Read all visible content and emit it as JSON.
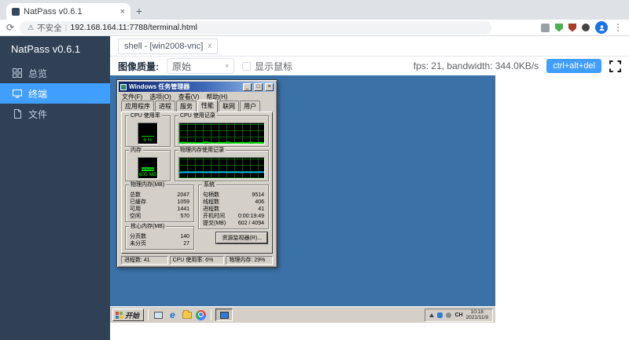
{
  "browser": {
    "tab": {
      "title": "NatPass v0.6.1",
      "close": "×"
    },
    "new_tab": "+",
    "security_label": "不安全",
    "url": "192.168.164.11:7788/terminal.html"
  },
  "sidebar": {
    "brand": "NatPass v0.6.1",
    "items": [
      {
        "label": "总览"
      },
      {
        "label": "终端"
      },
      {
        "label": "文件"
      }
    ]
  },
  "shell": {
    "tab_label": "shell - [win2008-vnc]",
    "tab_close": "x"
  },
  "toolbar": {
    "quality_label": "图像质量:",
    "quality_value": "原始",
    "show_cursor_label": "显示鼠标",
    "stats": "fps: 21, bandwidth: 344.0KB/s",
    "cad_button": "ctrl+alt+del"
  },
  "taskmgr": {
    "title": "Windows 任务管理器",
    "window_buttons": {
      "min": "_",
      "max": "□",
      "close": "×"
    },
    "menu": [
      {
        "label": "文件(F)"
      },
      {
        "label": "选项(O)"
      },
      {
        "label": "查看(V)"
      },
      {
        "label": "帮助(H)"
      }
    ],
    "tabs": [
      {
        "label": "应用程序"
      },
      {
        "label": "进程"
      },
      {
        "label": "服务"
      },
      {
        "label": "性能"
      },
      {
        "label": "联网"
      },
      {
        "label": "用户"
      }
    ],
    "cpu_gauge": {
      "title": "CPU 使用率",
      "value": "6 %",
      "percent": 8
    },
    "cpu_history": {
      "title": "CPU 使用记录",
      "values": [
        4,
        6,
        3,
        5,
        3,
        4,
        7,
        4,
        3,
        5,
        4,
        6,
        3,
        4,
        5,
        3,
        6,
        4,
        5,
        4
      ]
    },
    "mem_gauge": {
      "title": "内存",
      "value": "605 MB",
      "percent": 32
    },
    "mem_history": {
      "title": "物理内存使用记录",
      "values": [
        28,
        29,
        30,
        29,
        30,
        30,
        29,
        30,
        29,
        30,
        30,
        29,
        30,
        30,
        29,
        30,
        30,
        29,
        30,
        30
      ]
    },
    "physical": {
      "title": "物理内存(MB)",
      "rows": [
        {
          "label": "总数",
          "value": "2047"
        },
        {
          "label": "已缓存",
          "value": "1059"
        },
        {
          "label": "可用",
          "value": "1441"
        },
        {
          "label": "空闲",
          "value": "570"
        }
      ]
    },
    "kernel": {
      "title": "核心内存(MB)",
      "rows": [
        {
          "label": "分页数",
          "value": "140"
        },
        {
          "label": "未分页",
          "value": "27"
        }
      ]
    },
    "system": {
      "title": "系统",
      "rows": [
        {
          "label": "句柄数",
          "value": "9514"
        },
        {
          "label": "线程数",
          "value": "406"
        },
        {
          "label": "进程数",
          "value": "41"
        },
        {
          "label": "开机时间",
          "value": "0:00:19:49"
        },
        {
          "label": "提交(MB)",
          "value": "602 / 4094"
        }
      ]
    },
    "resource_button": "资源监视器(R)...",
    "status": [
      {
        "text": "进程数: 41"
      },
      {
        "text": "CPU 使用率: 6%"
      },
      {
        "text": "物理内存: 29%"
      }
    ]
  },
  "taskbar": {
    "start_label": "开始",
    "lang": "CH",
    "time": "10:18",
    "date": "2021/11/9"
  },
  "colors": {
    "accent": "#409eff",
    "sidebar_bg": "#304156",
    "desktop_blue": "#3a72a8",
    "led_green": "#00e000",
    "mem_line": "#00b0f0"
  }
}
